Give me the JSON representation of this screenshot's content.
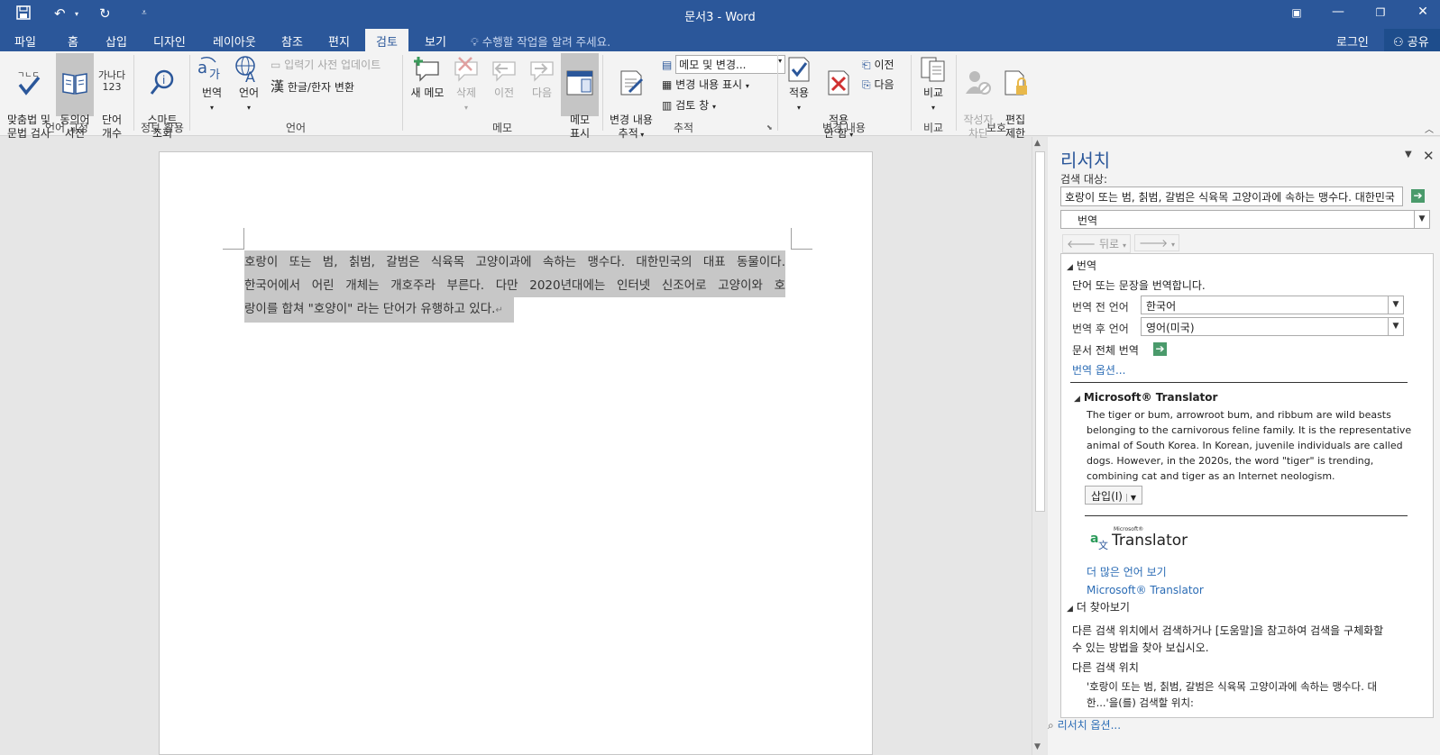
{
  "app": {
    "window_title": "문서3 - Word"
  },
  "tabs": [
    {
      "label": "파일"
    },
    {
      "label": "홈"
    },
    {
      "label": "삽입"
    },
    {
      "label": "디자인"
    },
    {
      "label": "레이아웃"
    },
    {
      "label": "참조"
    },
    {
      "label": "편지"
    },
    {
      "label": "검토",
      "active": true
    },
    {
      "label": "보기"
    }
  ],
  "tell_me": "수행할 작업을 알려 주세요.",
  "account": {
    "login": "로그인",
    "share": "공유"
  },
  "ribbon": {
    "groups": {
      "proofing": "언어 교정",
      "insights": "정보 활용",
      "language": "언어",
      "comments": "메모",
      "tracking": "추적",
      "changes": "변경 내용",
      "compare": "비교",
      "protect": "보호"
    },
    "spelling": "맞춤법 및\n문법 검사",
    "thesaurus": "동의어\n사전",
    "wordcount_icon": "가나다\n123",
    "wordcount": "단어\n개수",
    "smart_lookup": "스마트\n조회",
    "translate": "번역",
    "language": "언어",
    "ime_update": "입력기 사전 업데이트",
    "hanja": "한글/한자 변환",
    "new_comment": "새 메모",
    "delete": "삭제",
    "previous": "이전",
    "next": "다음",
    "show_comments": "메모\n표시",
    "track_changes": "변경 내용\n추적",
    "markup_dropdown": "메모 및 변경...",
    "show_markup": "변경 내용 표시",
    "review_pane": "검토 창",
    "accept": "적용",
    "reject": "적용\n안 함",
    "prev_change": "이전",
    "next_change": "다음",
    "compare": "비교",
    "block_authors": "작성자\n차단",
    "restrict_editing": "편집\n제한"
  },
  "document": {
    "line1": "호랑이 또는 범, 칡범, 갈범은 식육목 고양이과에 속하는 맹수다. 대한민국의 대표 동물이다.",
    "line2": "한국어에서 어린 개체는 개호주라 부른다. 다만 2020년대에는 인터넷 신조어로 고양이와 호",
    "line3": "랑이를 합쳐 \"호양이\" 라는 단어가 유행하고 있다.",
    "paragraph_mark": "↵"
  },
  "research_pane": {
    "title": "리서치",
    "search_label": "검색 대상:",
    "search_value": "호랑이 또는 범, 칡범, 갈범은 식육목 고양이과에 속하는 맹수다. 대한민국",
    "service": "번역",
    "back": "뒤로",
    "translation_header": "번역",
    "translation_desc": "단어 또는 문장을 번역합니다.",
    "from_label": "번역 전 언어",
    "from_value": "한국어",
    "to_label": "번역 후 언어",
    "to_value": "영어(미국)",
    "translate_doc": "문서 전체 번역",
    "options_link": "번역 옵션...",
    "ms_header": "Microsoft® Translator",
    "translation_result": "The tiger or bum, arrowroot bum, and ribbum are wild beasts belonging to the carnivorous feline family. It is the representative animal of South Korea. In Korean, juvenile individuals are called dogs. However, in the 2020s, the word \"tiger\" is trending, combining cat and tiger as an Internet neologism.",
    "insert": "삽입(I)",
    "logo_small": "Microsoft®",
    "logo_big": "Translator",
    "more_languages": "더 많은 언어 보기",
    "ms_link": "Microsoft® Translator",
    "find_more_header": "더 찾아보기",
    "find_more_text1": "다른 검색 위치에서 검색하거나 [도움말]을 참고하여 검색을 구체화할",
    "find_more_text2": "수 있는 방법을 찾아 보십시오.",
    "other_locations": "다른 검색 위치",
    "search_for1": "'호랑이 또는 범, 칡범, 갈범은 식육목 고양이과에 속하는 맹수다. 대",
    "search_for2": "한...'을(를) 검색할 위치:",
    "research_options": "리서치 옵션..."
  }
}
